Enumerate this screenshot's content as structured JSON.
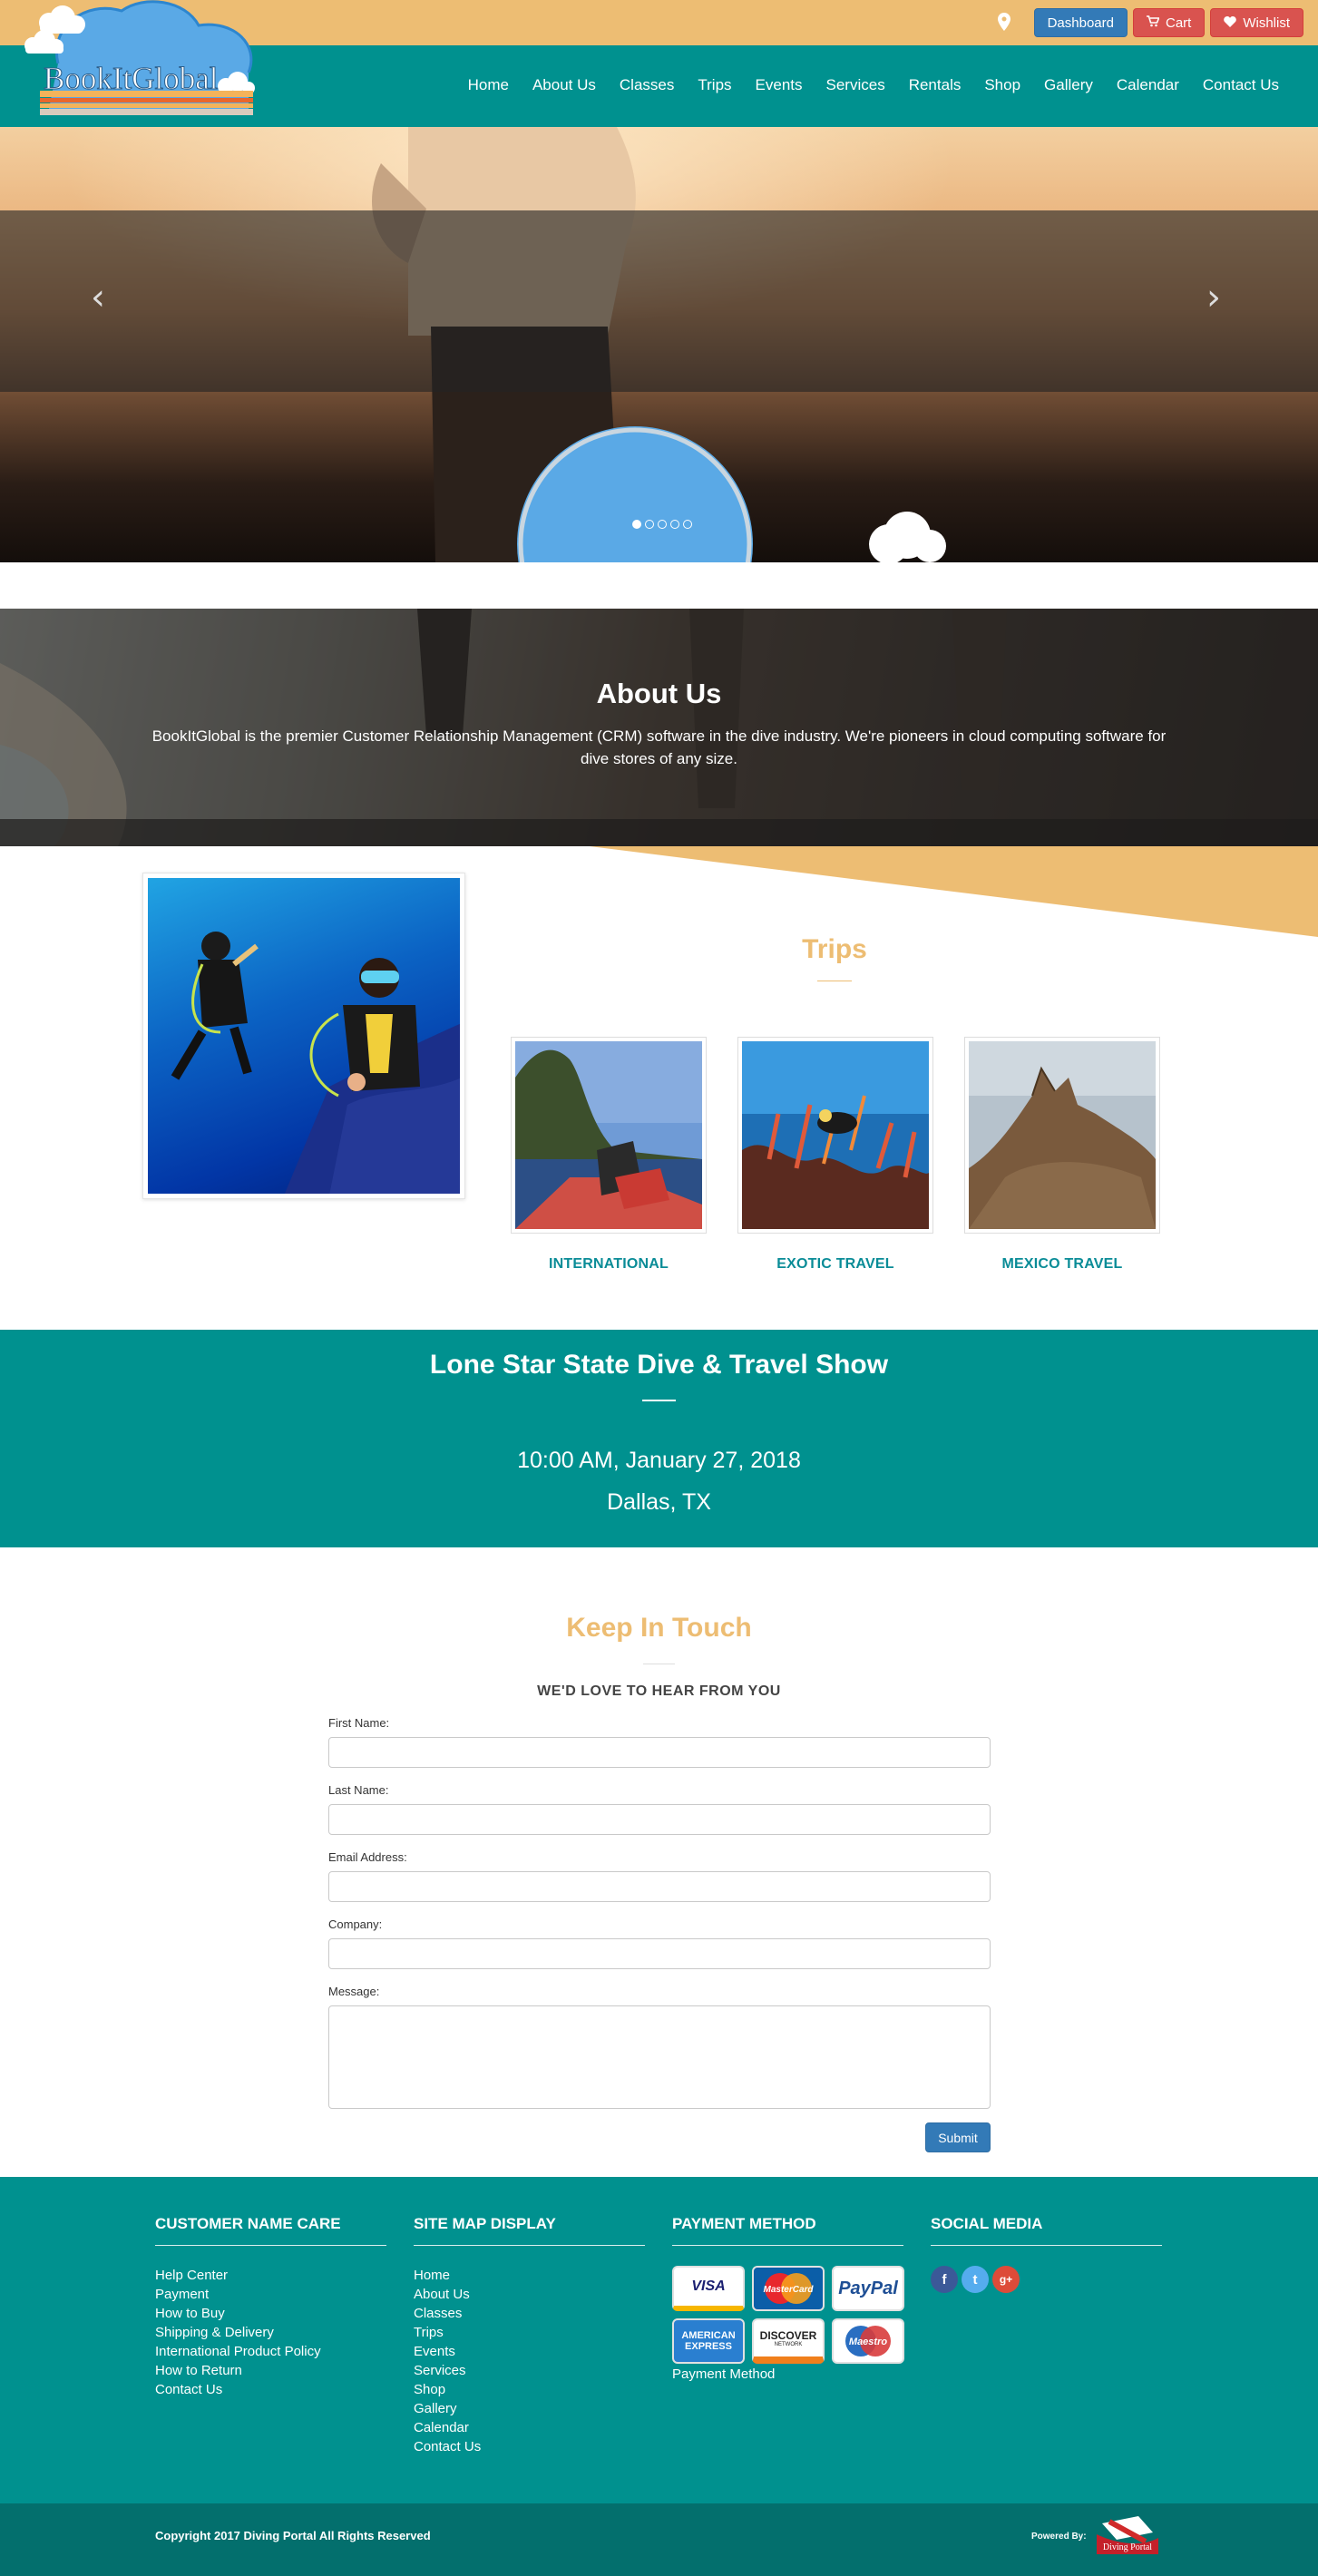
{
  "brand": {
    "name": "BookItGlobal"
  },
  "topbar": {
    "location_icon": "map-pin-icon",
    "dashboard_label": "Dashboard",
    "cart_label": "Cart",
    "wishlist_label": "Wishlist"
  },
  "nav": {
    "items": [
      "Home",
      "About Us",
      "Classes",
      "Trips",
      "Events",
      "Services",
      "Rentals",
      "Shop",
      "Gallery",
      "Calendar",
      "Contact Us"
    ]
  },
  "hero": {
    "prev_arrow": "‹",
    "next_arrow": "›",
    "slides": 5,
    "active_slide": 1
  },
  "about": {
    "title": "About Us",
    "text": "BookItGlobal is the premier Customer Relationship Management (CRM) software in the dive industry. We're pioneers in cloud computing software for dive stores of any size."
  },
  "trips": {
    "title": "Trips",
    "cards": [
      "INTERNATIONAL",
      "EXOTIC TRAVEL",
      "MEXICO TRAVEL"
    ]
  },
  "event": {
    "title": "Lone Star State Dive & Travel Show",
    "time": "10:00 AM, January 27, 2018",
    "place": "Dallas, TX"
  },
  "contact": {
    "title": "Keep In Touch",
    "subtitle": "WE'D LOVE TO HEAR FROM YOU",
    "first_name_label": "First Name:",
    "last_name_label": "Last Name:",
    "email_label": "Email Address:",
    "company_label": "Company:",
    "message_label": "Message:",
    "first_name_value": "",
    "last_name_value": "",
    "email_value": "",
    "company_value": "",
    "message_value": "",
    "submit_label": "Submit"
  },
  "footer": {
    "col1": {
      "title": "CUSTOMER NAME CARE",
      "links": [
        "Help Center",
        "Payment",
        "How to Buy",
        "Shipping & Delivery",
        "International Product Policy",
        "How to Return",
        "Contact Us"
      ]
    },
    "col2": {
      "title": "SITE MAP DISPLAY",
      "links": [
        "Home",
        "About Us",
        "Classes",
        "Trips",
        "Events",
        "Services",
        "Shop",
        "Gallery",
        "Calendar",
        "Contact Us"
      ]
    },
    "col3": {
      "title": "PAYMENT METHOD",
      "cards": [
        "VISA",
        "MasterCard",
        "PayPal",
        "AMERICAN EXPRESS",
        "DISCOVER",
        "Maestro"
      ],
      "discover_sub": "NETWORK",
      "caption": "Payment Method"
    },
    "col4": {
      "title": "SOCIAL MEDIA",
      "icons": [
        "facebook-icon",
        "twitter-icon",
        "google-plus-icon"
      ],
      "icon_glyphs": [
        "f",
        "t",
        "g+"
      ]
    },
    "copyright": "Copyright 2017 Diving Portal All Rights Reserved",
    "powered_by": "Powered By:",
    "powered_logo_text": "Diving Portal"
  },
  "colors": {
    "teal": "#00918f",
    "dark_teal": "#036f6d",
    "gold": "#edbd73",
    "blue_button": "#337ab7",
    "red_button": "#d9534f",
    "trip_label": "#0a8c97"
  }
}
